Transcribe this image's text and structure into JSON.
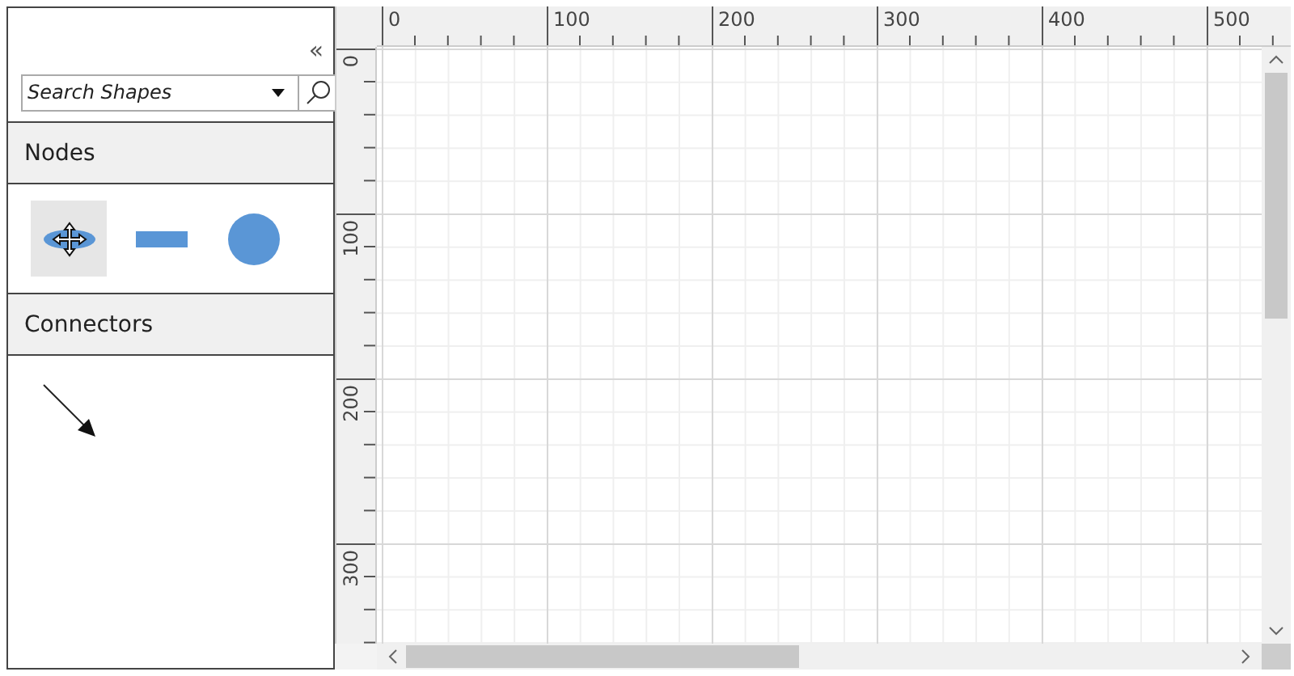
{
  "palette": {
    "collapse_glyph": "«",
    "search": {
      "placeholder": "Search Shapes"
    },
    "sections": [
      {
        "title": "Nodes",
        "items": [
          {
            "kind": "ellipse",
            "selected": true
          },
          {
            "kind": "rectangle",
            "selected": false
          },
          {
            "kind": "circle",
            "selected": false
          }
        ]
      },
      {
        "title": "Connectors",
        "items": [
          {
            "kind": "arrow",
            "selected": false
          }
        ]
      }
    ]
  },
  "canvas": {
    "horizontal_ruler": [
      "0",
      "100",
      "200",
      "300",
      "400",
      "500"
    ],
    "vertical_ruler": [
      "0",
      "100",
      "200",
      "300"
    ]
  }
}
